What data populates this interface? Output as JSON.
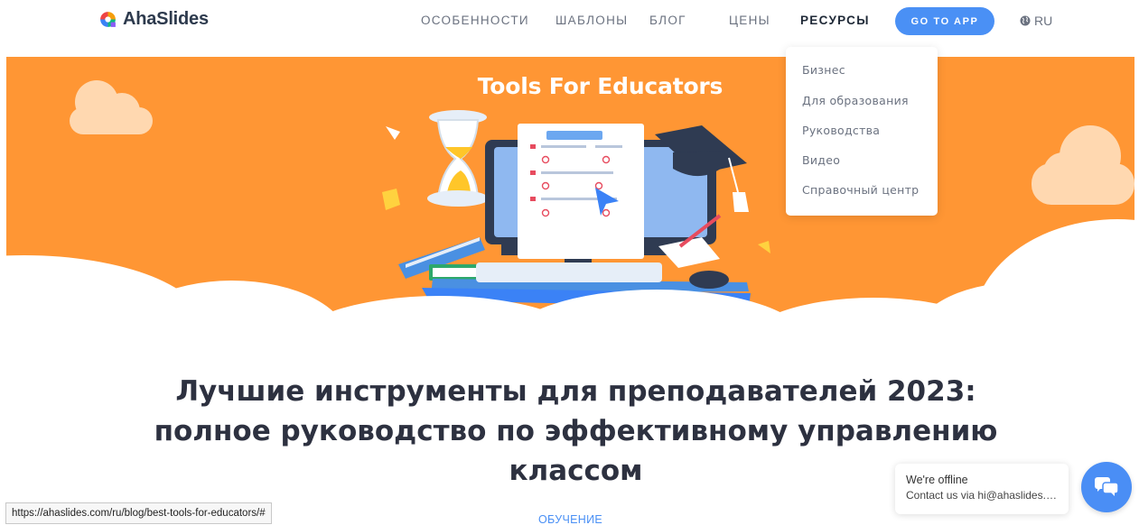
{
  "header": {
    "logo_text": "AhaSlides",
    "nav": [
      {
        "label": "ОСОБЕННОСТИ",
        "active": false
      },
      {
        "label": "ШАБЛОНЫ",
        "active": false
      },
      {
        "label": "БЛОГ",
        "active": false
      },
      {
        "label": "ЦЕНЫ",
        "active": false
      },
      {
        "label": "РЕСУРСЫ",
        "active": true
      }
    ],
    "cta_label": "GO TO APP",
    "language": "RU",
    "language_icon": "globe-icon"
  },
  "dropdown": {
    "items": [
      "Бизнес",
      "Для образования",
      "Руководства",
      "Видео",
      "Справочный центр"
    ]
  },
  "hero": {
    "title": "Tools For Educators"
  },
  "article": {
    "title_lines": [
      "Лучшие инструменты для преподавателей 2023:",
      "полное руководство по эффективному управлению",
      "классом"
    ],
    "category": "ОБУЧЕНИЕ"
  },
  "status_bar": {
    "url": "https://ahaslides.com/ru/blog/best-tools-for-educators/#"
  },
  "chat": {
    "status": "We're offline",
    "contact": "Contact us via hi@ahaslides.com",
    "icon": "chat-icon"
  },
  "colors": {
    "hero_bg": "#ff9634",
    "accent_blue": "#4a90f5",
    "cloud": "#ffd8b0"
  }
}
